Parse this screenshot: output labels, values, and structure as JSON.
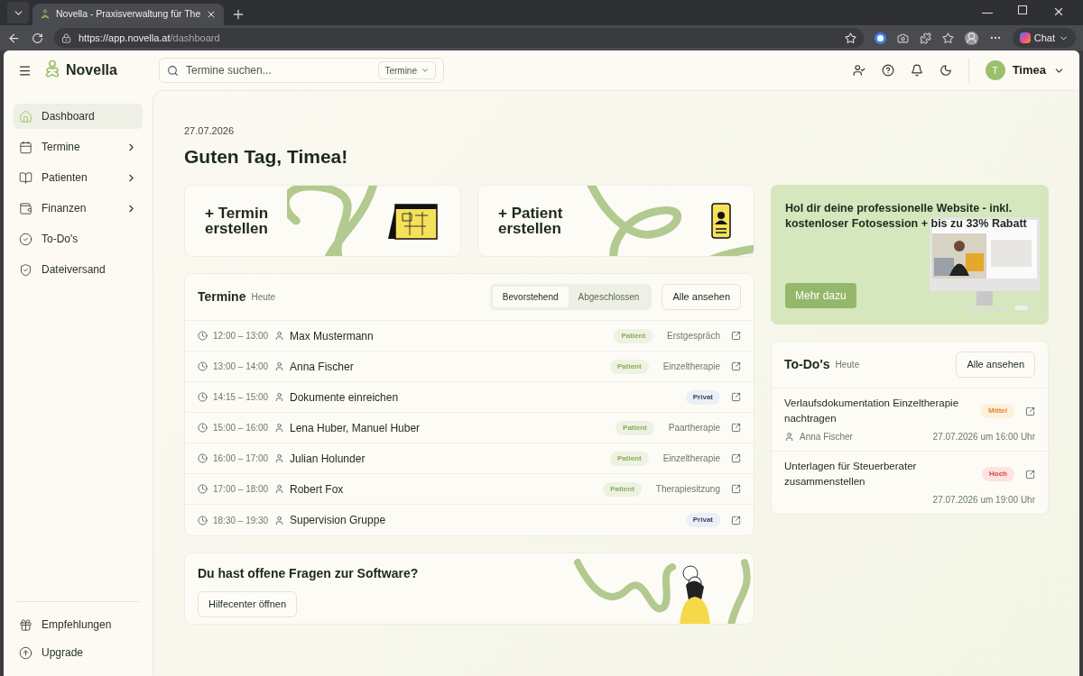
{
  "browser": {
    "tab_title": "Novella - Praxisverwaltung für The",
    "url_host": "https://app.novella.at",
    "url_path": "/dashboard",
    "chat_label": "Chat"
  },
  "app": {
    "logo": "Novella",
    "search": {
      "placeholder": "Termine suchen...",
      "scope": "Termine"
    },
    "user": {
      "initial": "T",
      "name": "Timea"
    }
  },
  "sidebar": {
    "items": [
      {
        "label": "Dashboard",
        "selected": true,
        "expandable": false
      },
      {
        "label": "Termine",
        "selected": false,
        "expandable": true
      },
      {
        "label": "Patienten",
        "selected": false,
        "expandable": true
      },
      {
        "label": "Finanzen",
        "selected": false,
        "expandable": true
      },
      {
        "label": "To-Do's",
        "selected": false,
        "expandable": false
      },
      {
        "label": "Dateiversand",
        "selected": false,
        "expandable": false
      }
    ],
    "bottom_items": [
      {
        "label": "Empfehlungen"
      },
      {
        "label": "Upgrade"
      }
    ]
  },
  "date": "27.07.2026",
  "greeting": "Guten Tag, Timea!",
  "actions": [
    {
      "label": "+ Termin erstellen",
      "kind": "calendar"
    },
    {
      "label": "+ Patient erstellen",
      "kind": "phone"
    }
  ],
  "appointments": {
    "title": "Termine",
    "subtitle": "Heute",
    "tabs": [
      {
        "label": "Bevorstehend",
        "selected": true
      },
      {
        "label": "Abgeschlossen",
        "selected": false
      }
    ],
    "all_button": "Alle ansehen",
    "rows": [
      {
        "time": "12:00 – 13:00",
        "name": "Max Mustermann",
        "badge": {
          "kind": "patient",
          "label": "Patient"
        },
        "type": "Erstgespräch"
      },
      {
        "time": "13:00 – 14:00",
        "name": "Anna Fischer",
        "badge": {
          "kind": "patient",
          "label": "Patient"
        },
        "type": "Einzeltherapie"
      },
      {
        "time": "14:15 – 15:00",
        "name": "Dokumente einreichen",
        "badge": {
          "kind": "private",
          "label": "Privat"
        }
      },
      {
        "time": "15:00 – 16:00",
        "name": "Lena Huber, Manuel Huber",
        "badge": {
          "kind": "patient",
          "label": "Patient"
        },
        "type": "Paartherapie"
      },
      {
        "time": "16:00 – 17:00",
        "name": "Julian Holunder",
        "badge": {
          "kind": "patient",
          "label": "Patient"
        },
        "type": "Einzeltherapie"
      },
      {
        "time": "17:00 – 18:00",
        "name": "Robert Fox",
        "badge": {
          "kind": "patient",
          "label": "Patient"
        },
        "type": "Therapiesitzung"
      },
      {
        "time": "18:30 – 19:30",
        "name": "Supervision Gruppe",
        "badge": {
          "kind": "private",
          "label": "Privat"
        }
      }
    ]
  },
  "help": {
    "title": "Du hast offene Fragen zur Software?",
    "button": "Hilfecenter öffnen"
  },
  "promo": {
    "title": "Hol dir deine professionelle Website - inkl. kostenloser Fotosession + bis zu 33% Rabatt",
    "button": "Mehr dazu"
  },
  "todos": {
    "title": "To-Do's",
    "subtitle": "Heute",
    "all_button": "Alle ansehen",
    "items": [
      {
        "title": "Verlaufsdokumentation Einzeltherapie nachtragen",
        "priority": {
          "kind": "medium",
          "label": "Mittel"
        },
        "person": "Anna Fischer",
        "due": "27.07.2026 um 16:00 Uhr"
      },
      {
        "title": "Unterlagen für Steuerberater zusammenstellen",
        "priority": {
          "kind": "high",
          "label": "Hoch"
        },
        "due": "27.07.2026 um 19:00 Uhr"
      }
    ]
  }
}
